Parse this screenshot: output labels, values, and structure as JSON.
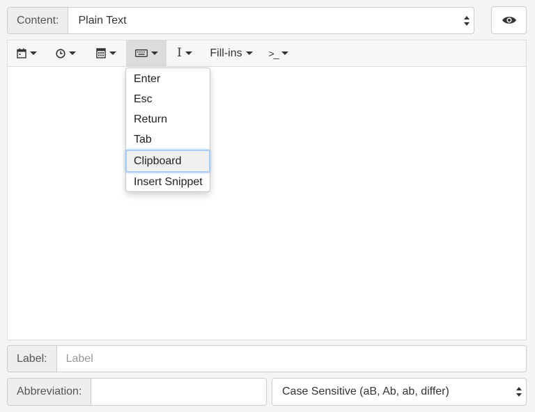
{
  "content": {
    "label": "Content:",
    "value": "Plain Text"
  },
  "preview": {
    "icon": "eye-icon"
  },
  "toolbar": {
    "buttons": [
      {
        "name": "date",
        "icon": "calendar-icon"
      },
      {
        "name": "time",
        "icon": "clock-icon"
      },
      {
        "name": "calculator",
        "icon": "calculator-icon"
      },
      {
        "name": "keys",
        "icon": "keyboard-icon",
        "active": true
      },
      {
        "name": "cursor",
        "icon": "text-cursor-icon",
        "glyph": "I"
      },
      {
        "name": "fill-ins",
        "label": "Fill-ins"
      },
      {
        "name": "script",
        "icon": "terminal-icon",
        "glyph": ">_"
      }
    ]
  },
  "keys_menu": {
    "items": [
      "Enter",
      "Esc",
      "Return",
      "Tab",
      "Clipboard",
      "Insert Snippet"
    ],
    "highlighted": "Clipboard"
  },
  "label_field": {
    "label": "Label:",
    "placeholder": "Label",
    "value": ""
  },
  "abbreviation": {
    "label": "Abbreviation:",
    "value": ""
  },
  "case_mode": {
    "value": "Case Sensitive (aB, Ab, ab, differ)"
  },
  "colors": {
    "addon_bg": "#eeeeee",
    "border": "#cccccc",
    "highlight_ring": "#a9ccf3",
    "active_tool_bg": "#dcdcdc"
  }
}
